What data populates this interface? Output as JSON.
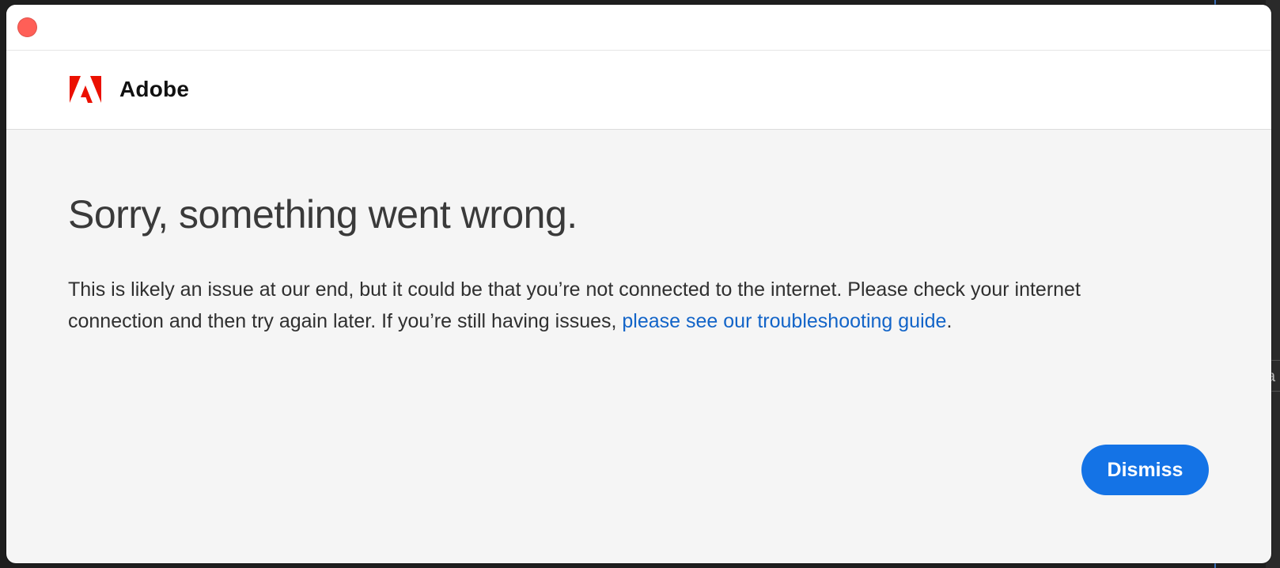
{
  "window": {
    "close_icon": "close-icon"
  },
  "header": {
    "brand": "Adobe",
    "logo_icon": "adobe-logo-icon",
    "logo_color": "#eb1000"
  },
  "error": {
    "heading": "Sorry, something went wrong.",
    "message_prefix": "This is likely an issue at our end, but it could be that you’re not connected to the internet. Please check your internet connection and then try again later. If you’re still having issues, ",
    "link_text": "please see our troubleshooting guide",
    "message_suffix": "."
  },
  "actions": {
    "dismiss_label": "Dismiss",
    "accent": "#1473e6"
  },
  "background": {
    "peek_text": "a"
  }
}
